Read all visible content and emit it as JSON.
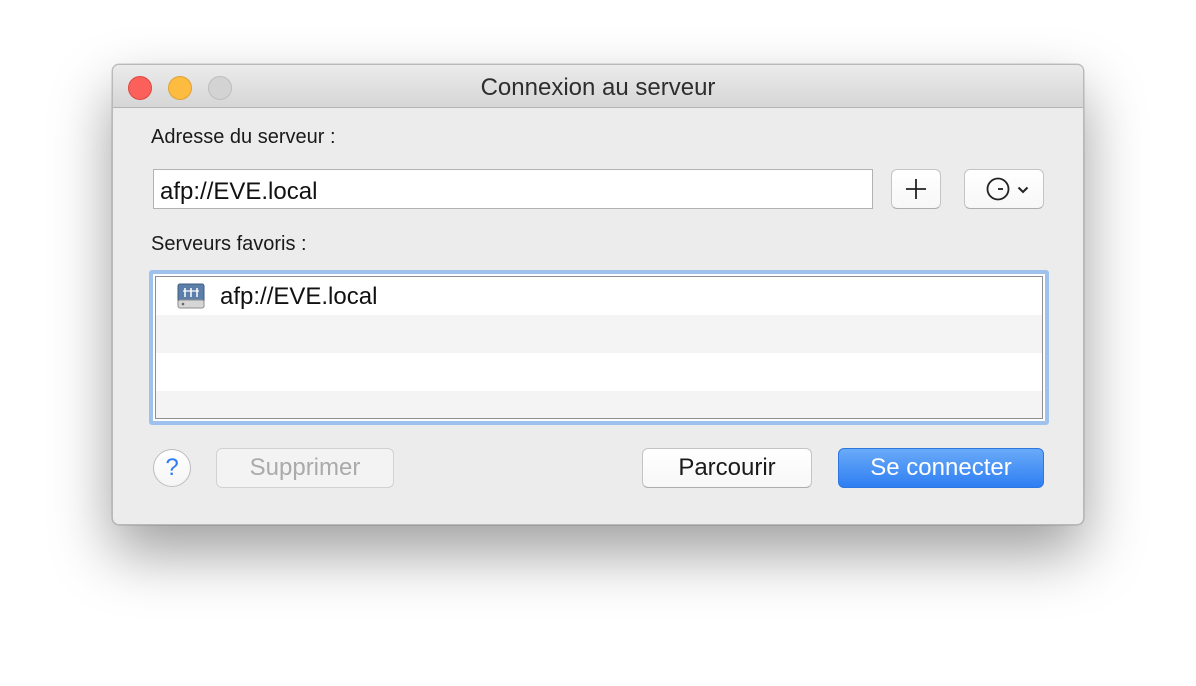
{
  "window": {
    "title": "Connexion au serveur"
  },
  "form": {
    "address_label": "Adresse du serveur :",
    "address_value": "afp://EVE.local",
    "favorites_label": "Serveurs favoris :"
  },
  "icons": {
    "add": "plus-icon",
    "recent": "clock-icon",
    "dropdown": "chevron-down-icon",
    "server": "file-server-icon"
  },
  "favorites": [
    {
      "label": "afp://EVE.local"
    }
  ],
  "buttons": {
    "help": "?",
    "delete": "Supprimer",
    "browse": "Parcourir",
    "connect": "Se connecter"
  },
  "colors": {
    "accent": "#2f7ff3",
    "close": "#fc605b",
    "minimize": "#fdbc40",
    "zoom_disabled": "#d3d3d3",
    "focus_ring": "#9fc1ee"
  }
}
